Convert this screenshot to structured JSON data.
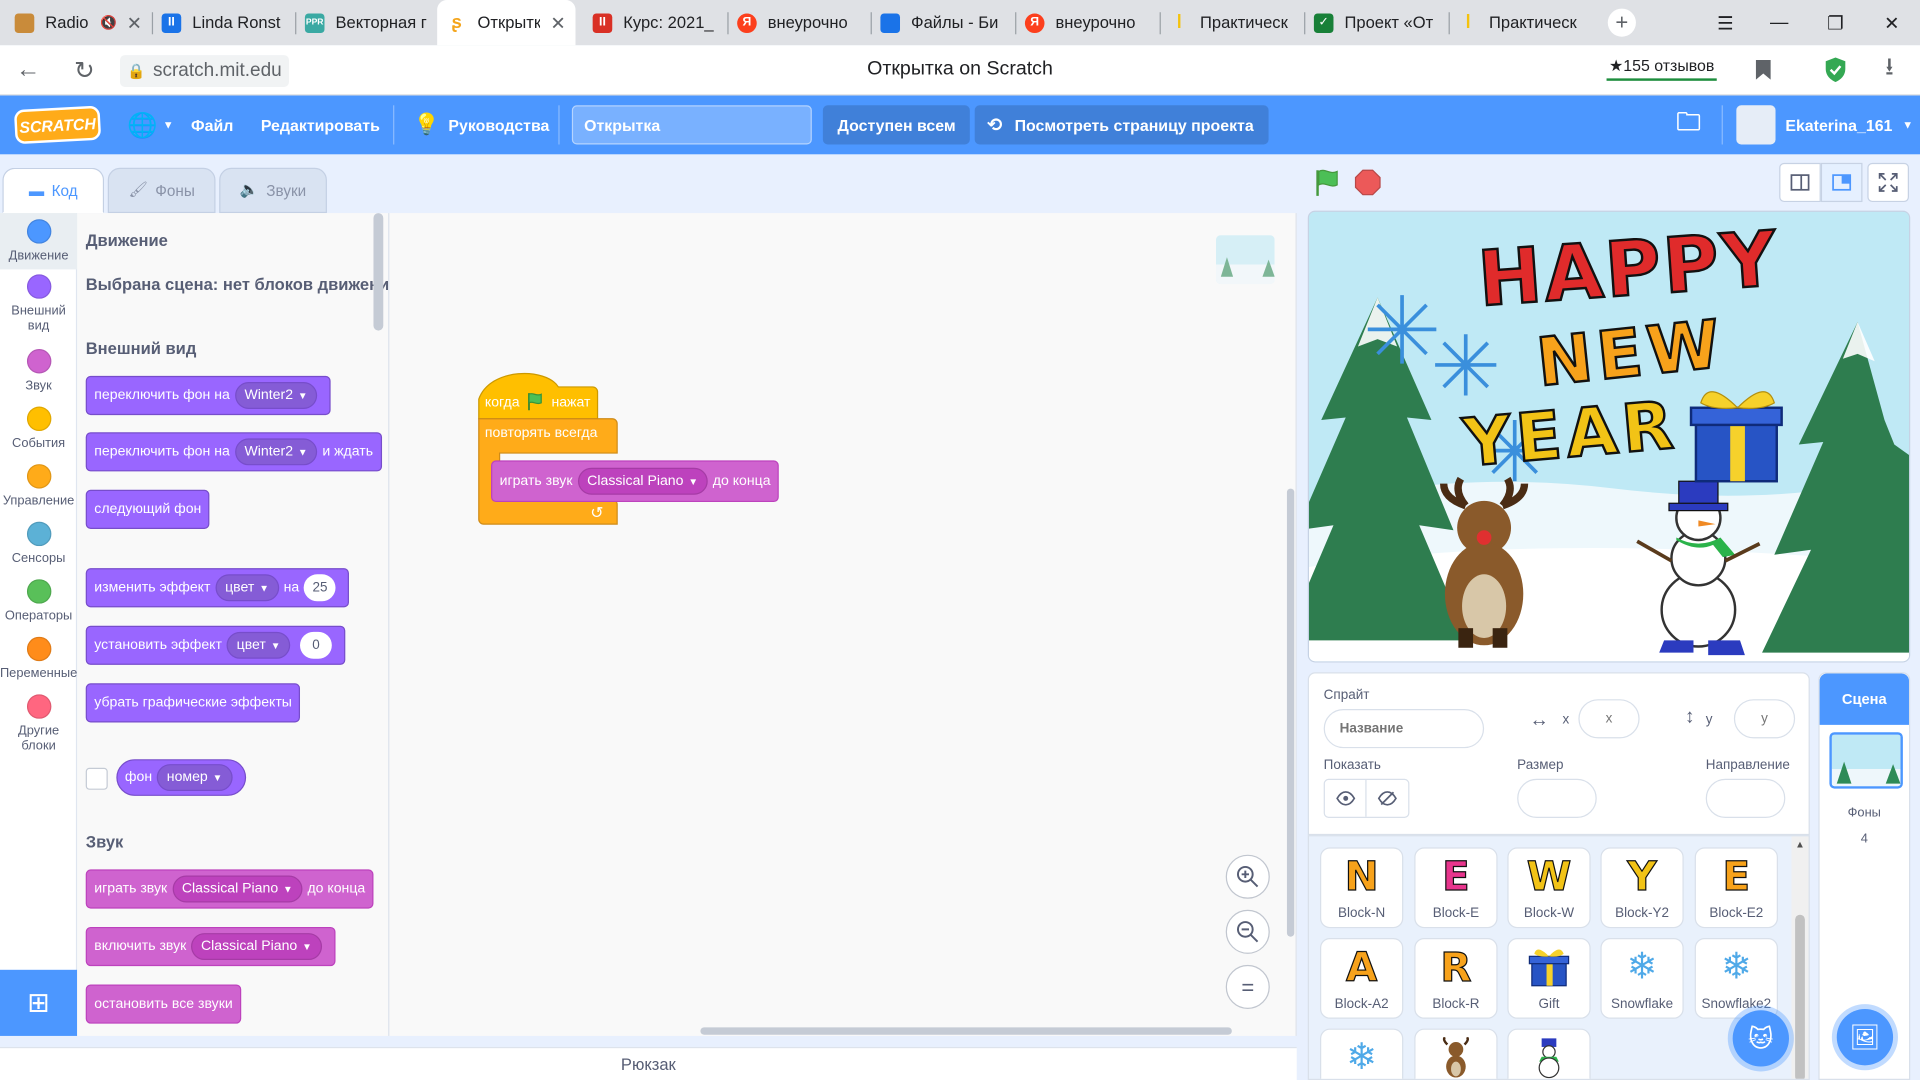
{
  "browser": {
    "tabs": [
      {
        "title": "Radio",
        "extra": "🔇",
        "color": "#c98b3a"
      },
      {
        "title": "Linda Ronst",
        "color": "#1a73e8"
      },
      {
        "title": "Векторная г",
        "color": "#3aa9a3"
      },
      {
        "title": "Открытк",
        "color": "#f4a51c",
        "active": true
      },
      {
        "title": "Курс: 2021_",
        "color": "#d93025"
      },
      {
        "title": "внеурочно",
        "color": "#fc3f1d"
      },
      {
        "title": "Файлы - Би",
        "color": "#1a73e8"
      },
      {
        "title": "внеурочно",
        "color": "#fc3f1d"
      },
      {
        "title": "Практическ",
        "color": "#f4c20d"
      },
      {
        "title": "Проект «От",
        "color": "#188038"
      },
      {
        "title": "Практическ",
        "color": "#f4c20d"
      }
    ],
    "tab_icon_labels": {
      "linda": "II",
      "vector": "PPR",
      "kurs": "II",
      "yandex": "Я"
    },
    "new_tab": "+",
    "url": "scratch.mit.edu",
    "page_title": "Открытка on Scratch",
    "reviews": "★155 отзывов"
  },
  "menu": {
    "logo": "SCRATCH",
    "file": "Файл",
    "edit": "Редактировать",
    "tutorials": "Руководства",
    "project_title": "Открытка",
    "share": "Доступен всем",
    "see_project": "Посмотреть страницу проекта",
    "username": "Ekaterina_161"
  },
  "editor_tabs": {
    "code": "Код",
    "backdrops": "Фоны",
    "sounds": "Звуки"
  },
  "categories": [
    {
      "label": "Движение",
      "color": "#4c97ff"
    },
    {
      "label": "Внешний вид",
      "color": "#9966ff"
    },
    {
      "label": "Звук",
      "color": "#cf63cf"
    },
    {
      "label": "События",
      "color": "#ffbf00"
    },
    {
      "label": "Управление",
      "color": "#ffab19"
    },
    {
      "label": "Сенсоры",
      "color": "#5cb1d6"
    },
    {
      "label": "Операторы",
      "color": "#59c059"
    },
    {
      "label": "Переменные",
      "color": "#ff8c1a"
    },
    {
      "label": "Другие блоки",
      "color": "#ff6680"
    }
  ],
  "palette": {
    "motion_heading": "Движение",
    "motion_note": "Выбрана сцена: нет блоков движени",
    "looks_heading": "Внешний вид",
    "switch_backdrop": "переключить фон на",
    "backdrop_name": "Winter2",
    "and_wait": "и ждать",
    "next_backdrop": "следующий фон",
    "change_effect": "изменить эффект",
    "effect_name": "цвет",
    "by": "на",
    "change_value": "25",
    "set_effect": "установить эффект",
    "set_value": "0",
    "clear_effects": "убрать графические эффекты",
    "backdrop_reporter": "фон",
    "backdrop_reporter_option": "номер",
    "sound_heading": "Звук",
    "play_sound": "играть звук",
    "sound_name": "Classical Piano",
    "until_done": "до конца",
    "start_sound": "включить звук",
    "stop_sounds": "остановить все звуки"
  },
  "script": {
    "when": "когда",
    "clicked": "нажат",
    "forever": "повторять всегда",
    "play_sound": "играть звук",
    "sound_name": "Classical Piano",
    "until_done": "до конца"
  },
  "zoom": {
    "in": "+",
    "out": "−",
    "reset": "="
  },
  "backpack": "Рюкзак",
  "stage_text": {
    "line1": "HAPPY",
    "line2": "NEW",
    "line3": "YEAR"
  },
  "sprite_info": {
    "sprite_label": "Спрайт",
    "name_placeholder": "Название",
    "x_label": "x",
    "x_placeholder": "x",
    "y_label": "y",
    "y_placeholder": "y",
    "show_label": "Показать",
    "size_label": "Размер",
    "direction_label": "Направление"
  },
  "sprites": [
    {
      "glyph": "N",
      "name": "Block-N",
      "color": "#f7a21b"
    },
    {
      "glyph": "E",
      "name": "Block-E",
      "color": "#e8358d"
    },
    {
      "glyph": "W",
      "name": "Block-W",
      "color": "#f2c316"
    },
    {
      "glyph": "Y",
      "name": "Block-Y2",
      "color": "#f2c316"
    },
    {
      "glyph": "E",
      "name": "Block-E2",
      "color": "#f7a21b"
    },
    {
      "glyph": "A",
      "name": "Block-A2",
      "color": "#f7a21b"
    },
    {
      "glyph": "R",
      "name": "Block-R",
      "color": "#f7a21b"
    },
    {
      "glyph": "🎁",
      "name": "Gift",
      "color": "#2754c5"
    },
    {
      "glyph": "❄",
      "name": "Snowflake",
      "color": "#4fa9e8"
    },
    {
      "glyph": "❄",
      "name": "Snowflake2",
      "color": "#4fa9e8"
    },
    {
      "glyph": "❄",
      "name": "",
      "color": "#4fa9e8"
    },
    {
      "glyph": "",
      "name": "",
      "color": "#8a5a2b"
    },
    {
      "glyph": "",
      "name": "",
      "color": "#2b2b2b"
    }
  ],
  "stage_panel": {
    "title": "Сцена",
    "backdrops_label": "Фоны",
    "backdrops_count": "4"
  },
  "colors": {
    "scratch_blue": "#4c97ff",
    "looks": "#9966ff",
    "sound": "#cf63cf",
    "events": "#ffbf00",
    "control": "#ffab19"
  }
}
